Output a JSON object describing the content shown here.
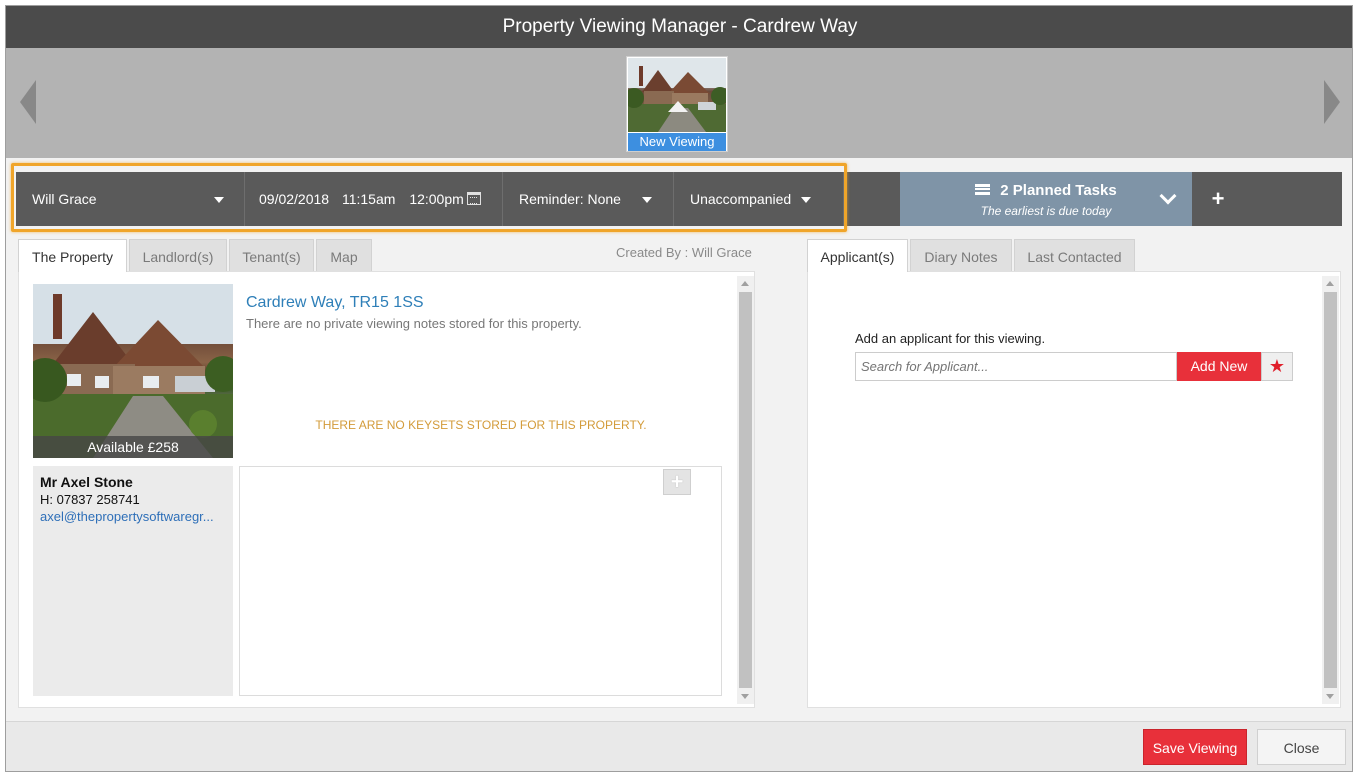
{
  "window": {
    "title": "Property Viewing Manager - Cardrew Way"
  },
  "carousel": {
    "current_label": "New Viewing"
  },
  "toolbar": {
    "negotiator": "Will Grace",
    "date": "09/02/2018",
    "start_time": "11:15am",
    "end_time": "12:00pm",
    "reminder": "Reminder: None",
    "accompaniment": "Unaccompanied"
  },
  "tasks": {
    "title": "2 Planned Tasks",
    "subtitle": "The earliest is due today"
  },
  "left_tabs": [
    "The Property",
    "Landlord(s)",
    "Tenant(s)",
    "Map"
  ],
  "created_by": "Created By : Will Grace",
  "property": {
    "address": "Cardrew Way, TR15 1SS",
    "notes": "There are no private viewing notes stored for this property.",
    "availability": "Available £258",
    "keysets_message": "THERE ARE NO KEYSETS STORED FOR THIS PROPERTY."
  },
  "contact": {
    "name": "Mr Axel Stone",
    "phone": "H: 07837 258741",
    "email": "axel@thepropertysoftwaregr..."
  },
  "right_tabs": [
    "Applicant(s)",
    "Diary Notes",
    "Last Contacted"
  ],
  "applicants": {
    "prompt": "Add an applicant for this viewing.",
    "search_placeholder": "Search for Applicant...",
    "add_new_label": "Add New"
  },
  "footer": {
    "save_label": "Save Viewing",
    "close_label": "Close"
  },
  "colors": {
    "title_bar": "#4b4b4b",
    "toolbar": "#5a5a5a",
    "tasks_panel": "#7f94a7",
    "accent_red": "#e8303a",
    "highlight_orange": "#f0a52a",
    "link_blue": "#2e7fb8"
  },
  "icons": {
    "prev": "arrow-left-icon",
    "next": "arrow-right-icon",
    "calendar": "calendar-icon",
    "tasks": "list-icon",
    "expand": "chevron-down-icon",
    "add": "plus-icon",
    "favourite": "star-icon"
  }
}
